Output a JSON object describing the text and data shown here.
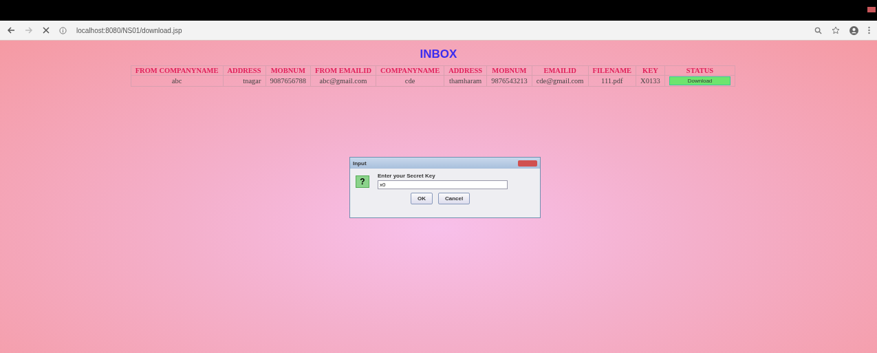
{
  "browser": {
    "url": "localhost:8080/NS01/download.jsp"
  },
  "page": {
    "title": "INBOX"
  },
  "table": {
    "columns": [
      "FROM COMPANYNAME",
      "ADDRESS",
      "MOBNUM",
      "FROM EMAILID",
      "COMPANYNAME",
      "ADDRESS",
      "MOBNUM",
      "EMAILID",
      "FILENAME",
      "KEY",
      "STATUS"
    ],
    "rows": [
      {
        "cells": [
          "abc",
          "tnagar",
          "9087656788",
          "abc@gmail.com",
          "cde",
          "thamharam",
          "9876543213",
          "cde@gmail.com",
          "111.pdf",
          "X0133"
        ],
        "action": "Download"
      }
    ]
  },
  "dialog": {
    "title": "Input",
    "icon": "?",
    "prompt": "Enter your Secret Key",
    "value": "x0",
    "buttons": [
      "OK",
      "Cancel"
    ]
  }
}
